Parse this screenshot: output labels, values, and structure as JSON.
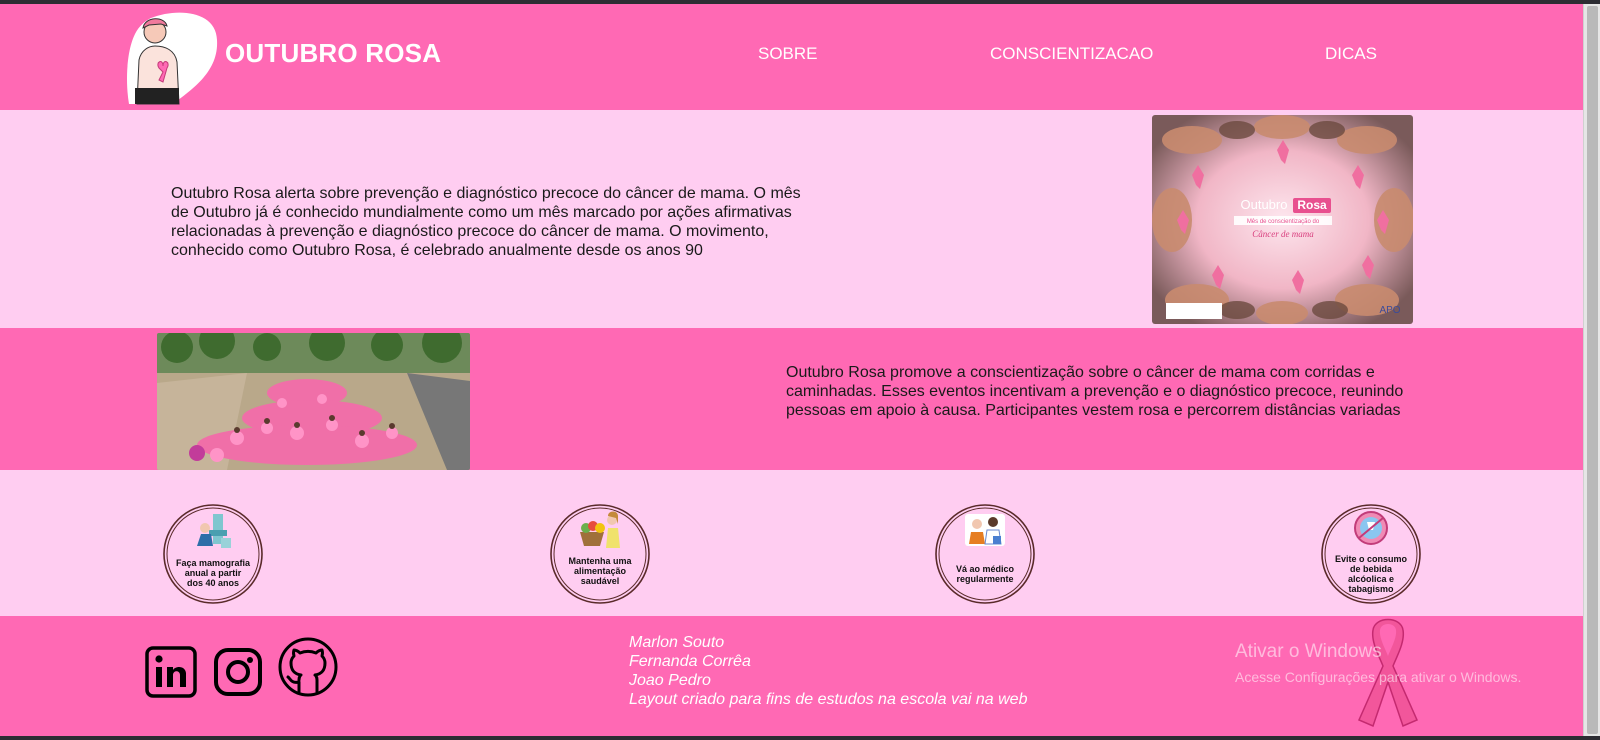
{
  "header": {
    "brand": "OUTUBRO ROSA",
    "nav": [
      "SOBRE",
      "CONSCIENTIZACAO",
      "DICAS"
    ]
  },
  "section1": {
    "text": "Outubro Rosa alerta sobre prevenção e diagnóstico precoce do câncer de mama. O mês de Outubro já é conhecido mundialmente como um mês marcado por ações afirmativas relacionadas à prevenção e diagnóstico precoce do câncer de mama. O movimento, conhecido como Outubro Rosa, é celebrado anualmente desde os anos 90",
    "image": {
      "title": "Outubro Rosa",
      "subtitle": "Mês de conscientização do",
      "caption": "Câncer de mama",
      "badge": "APO"
    }
  },
  "section2": {
    "text": "Outubro Rosa promove a conscientização sobre o câncer de mama com corridas e caminhadas. Esses eventos incentivam a prevenção e o diagnóstico precoce, reunindo pessoas em apoio à causa. Participantes vestem rosa e percorrem distâncias variadas"
  },
  "tips": [
    {
      "line1": "Faça mamografia",
      "line2": "anual a partir",
      "line3": "dos 40 anos",
      "line4": ""
    },
    {
      "line1": "Mantenha uma",
      "line2": "alimentação",
      "line3": "saudável",
      "line4": ""
    },
    {
      "line1": "Vá ao médico",
      "line2": "regularmente",
      "line3": "",
      "line4": ""
    },
    {
      "line1": "Evite o consumo",
      "line2": "de bebida",
      "line3": "alcóolica e",
      "line4": "tabagismo"
    }
  ],
  "footer": {
    "credits": [
      "Marlon Souto",
      "Fernanda Corrêa",
      "Joao Pedro",
      "Layout criado para fins de estudos na escola vai na web"
    ],
    "social_icons": [
      "linkedin-icon",
      "instagram-icon",
      "github-icon"
    ]
  },
  "watermark": {
    "title": "Ativar o Windows",
    "subtitle": "Acesse Configurações para ativar o Windows."
  },
  "colors": {
    "primary_pink": "#ff69b4",
    "light_pink": "#ffcdf1",
    "text_dark": "#1a1a1a"
  }
}
